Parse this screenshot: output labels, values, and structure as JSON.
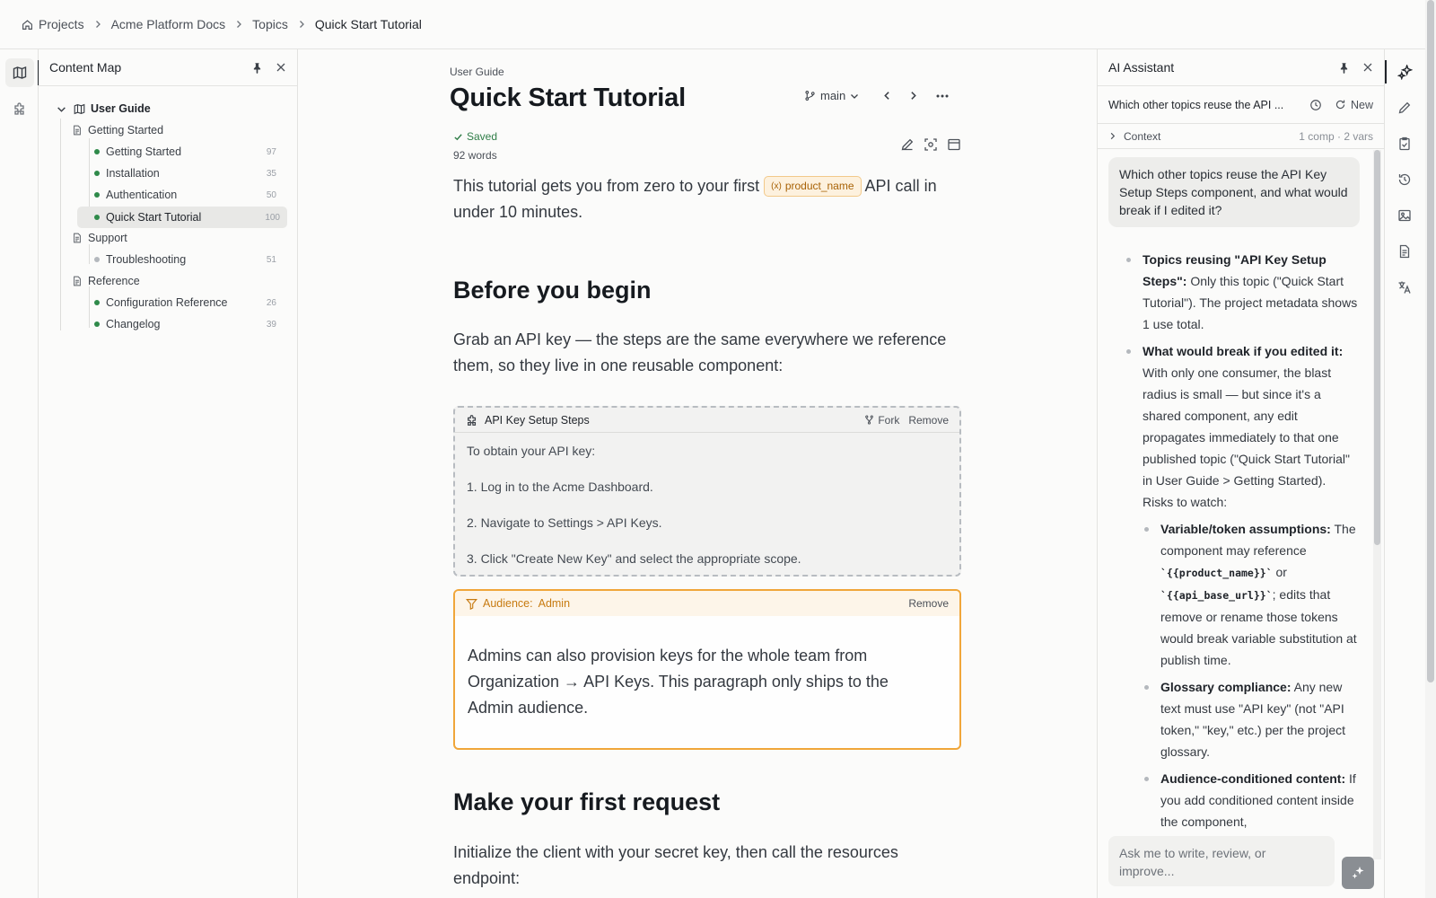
{
  "breadcrumb": [
    "Projects",
    "Acme Platform Docs",
    "Topics",
    "Quick Start Tutorial"
  ],
  "content_map": {
    "title": "Content Map",
    "root": "User Guide",
    "items": [
      {
        "label": "Getting Started",
        "kind": "folder"
      },
      {
        "label": "Getting Started",
        "kind": "topic",
        "count": "97",
        "status": "published"
      },
      {
        "label": "Installation",
        "kind": "topic",
        "count": "35",
        "status": "published"
      },
      {
        "label": "Authentication",
        "kind": "topic",
        "count": "50",
        "status": "published"
      },
      {
        "label": "Quick Start Tutorial",
        "kind": "topic",
        "count": "100",
        "status": "published",
        "selected": true
      },
      {
        "label": "Support",
        "kind": "folder"
      },
      {
        "label": "Troubleshooting",
        "kind": "topic",
        "count": "51",
        "status": "draft"
      },
      {
        "label": "Reference",
        "kind": "folder"
      },
      {
        "label": "Configuration Reference",
        "kind": "topic",
        "count": "26",
        "status": "published"
      },
      {
        "label": "Changelog",
        "kind": "topic",
        "count": "39",
        "status": "published"
      }
    ]
  },
  "doc": {
    "eyebrow": "User Guide",
    "title": "Quick Start Tutorial",
    "branch": "main",
    "saved": "Saved",
    "words": "92 words",
    "intro_before": "This tutorial gets you from zero to your first",
    "intro_token": "product_name",
    "intro_after": "API call in under 10 minutes.",
    "h_before": "Before you begin",
    "p_before": "Grab an API key — the steps are the same everywhere we reference them, so they live in one reusable component:",
    "component": {
      "name": "API Key Setup Steps",
      "fork": "Fork",
      "remove": "Remove",
      "lines": [
        "To obtain your API key:",
        "1. Log in to the Acme Dashboard.",
        "2. Navigate to Settings > API Keys.",
        "3. Click \"Create New Key\" and select the appropriate scope."
      ]
    },
    "audience": {
      "label": "Audience:",
      "value": "Admin",
      "remove": "Remove",
      "text": "Admins can also provision keys for the whole team from Organization → API Keys. This paragraph only ships to the Admin audience."
    },
    "h_first": "Make your first request",
    "p_first": "Initialize the client with your secret key, then call the resources endpoint:"
  },
  "ai": {
    "title": "AI Assistant",
    "question_short": "Which other topics reuse the API ...",
    "new_label": "New",
    "context_label": "Context",
    "context_meta": "1 comp · 2 vars",
    "user_message": "Which other topics reuse the API Key Setup Steps component, and what would break if I edited it?",
    "a1_bold": "Topics reusing \"API Key Setup Steps\":",
    "a1_text": " Only this topic (\"Quick Start Tutorial\"). The project metadata shows 1 use total.",
    "a2_bold": "What would break if you edited it:",
    "a2_text": " With only one consumer, the blast radius is small — but since it's a shared component, any edit propagates immediately to that one published topic (\"Quick Start Tutorial\" in User Guide > Getting Started). Risks to watch:",
    "s1_bold": "Variable/token assumptions:",
    "s1_text_a": " The component may reference ",
    "s1_code_a": "`{{product_name}}`",
    "s1_text_b": " or ",
    "s1_code_b": "`{{api_base_url}}`",
    "s1_text_c": "; edits that remove or rename those tokens would break variable substitution at publish time.",
    "s2_bold": "Glossary compliance:",
    "s2_text": " Any new text must use \"API key\" (not \"API token,\" \"key,\" etc.) per the project glossary.",
    "s3_bold": "Audience-conditioned content:",
    "s3_text": " If you add conditioned content inside the component,",
    "input_placeholder": "Ask me to write, review, or improve..."
  },
  "colors": {
    "accent_published": "#2f8a4a",
    "audience_border": "#f0a63a",
    "token_text": "#a86206"
  }
}
